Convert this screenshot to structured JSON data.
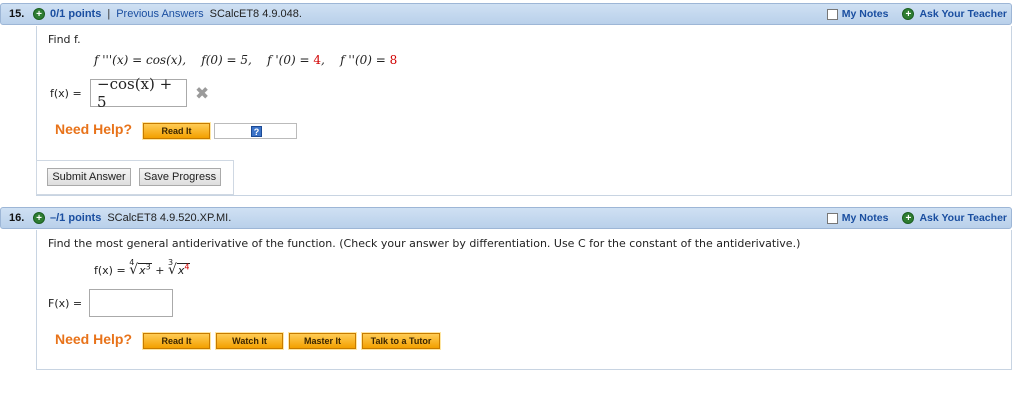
{
  "q15": {
    "number": "15.",
    "points": "0/1 points",
    "separator": "|",
    "previous_answers": "Previous Answers",
    "reference": "SCalcET8 4.9.048.",
    "my_notes": "My Notes",
    "ask_teacher": "Ask Your Teacher",
    "prompt": "Find f.",
    "conditions": {
      "c1": "f '''(x) = cos(x),",
      "c2": "f(0) = 5,",
      "c3a": "f '(0) = ",
      "c3b": "4",
      "c3c": ",",
      "c4a": "f ''(0) = ",
      "c4b": "8"
    },
    "answer_label": "f(x) =",
    "answer_value": "−cos(x) + 5",
    "status_icon": "x-mark-icon",
    "need_help": "Need Help?",
    "read_it": "Read It",
    "help_icon": "?",
    "submit": "Submit Answer",
    "save": "Save Progress"
  },
  "q16": {
    "number": "16.",
    "points": "–/1 points",
    "reference": "SCalcET8 4.9.520.XP.MI.",
    "my_notes": "My Notes",
    "ask_teacher": "Ask Your Teacher",
    "prompt": "Find the most general antiderivative of the function. (Check your answer by differentiation. Use C for the constant of the antiderivative.)",
    "func_lhs": "f(x) = ",
    "rad1_index": "4",
    "rad1_base": "x",
    "rad1_exp": "3",
    "plus": " + ",
    "rad2_index": "3",
    "rad2_base": "x",
    "rad2_exp": "4",
    "answer_label": "F(x) =",
    "answer_value": "",
    "need_help": "Need Help?",
    "read_it": "Read It",
    "watch_it": "Watch It",
    "master_it": "Master It",
    "talk_tutor": "Talk to a Tutor"
  },
  "colors": {
    "header_blue": "#b9d0ea",
    "link_blue": "#1a4ea0",
    "help_orange": "#e8731a",
    "button_orange": "#f3a000",
    "red": "#d00000"
  }
}
